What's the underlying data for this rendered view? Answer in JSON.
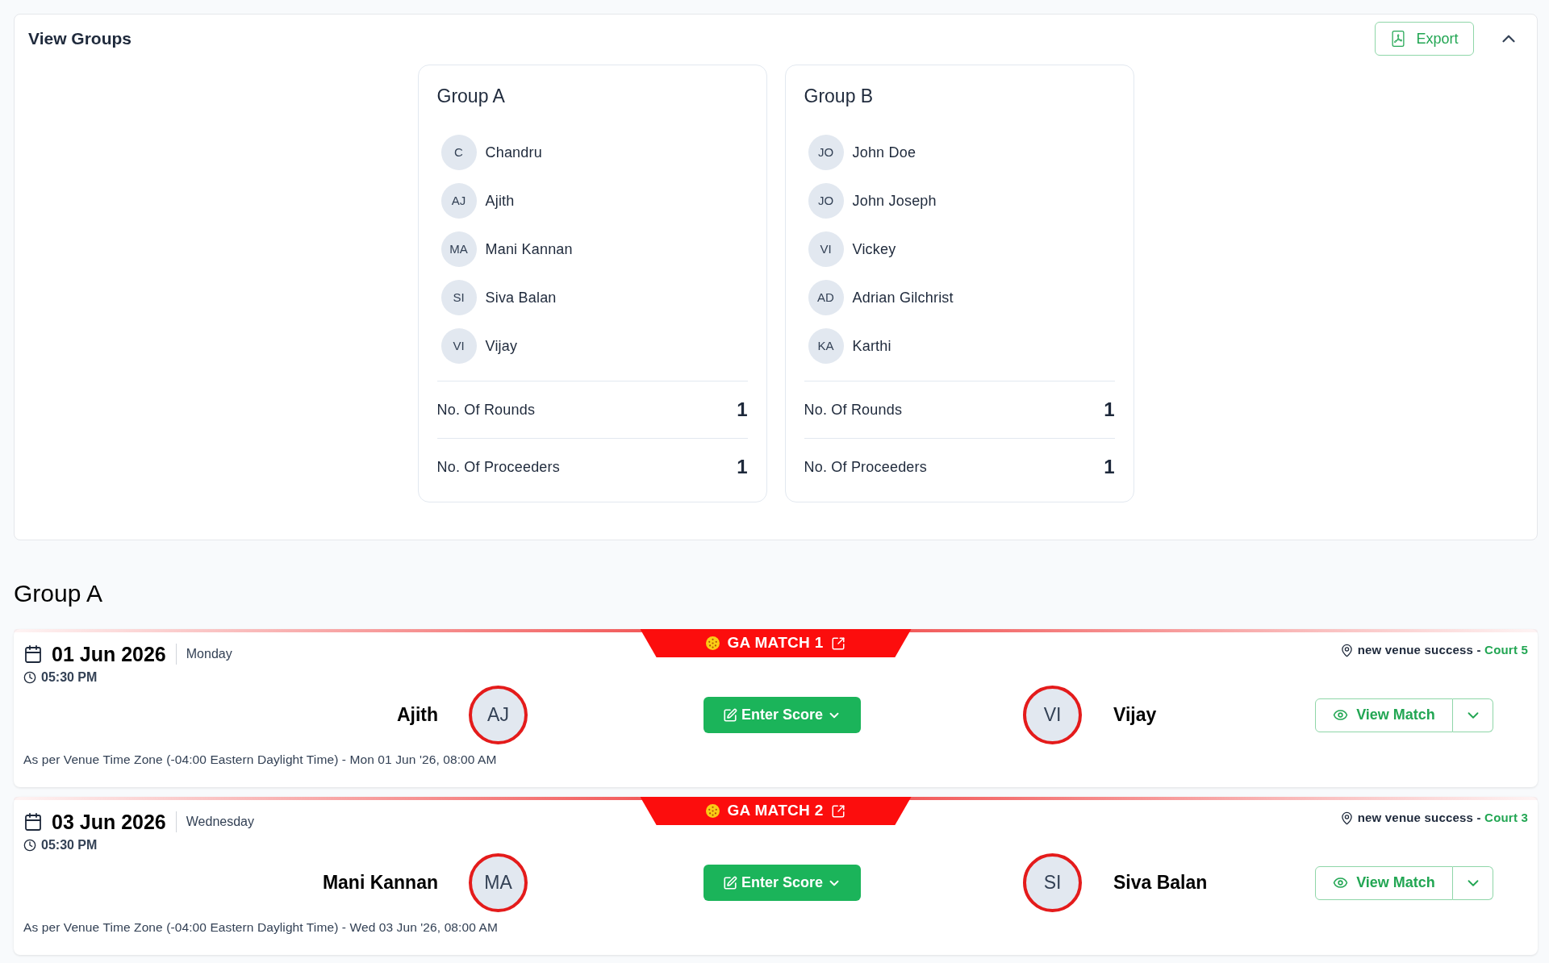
{
  "panel": {
    "title": "View Groups",
    "export_button": "Export",
    "expanded": true
  },
  "groups": [
    {
      "name": "Group A",
      "members": [
        {
          "initials": "C",
          "name": "Chandru"
        },
        {
          "initials": "AJ",
          "name": "Ajith"
        },
        {
          "initials": "MA",
          "name": "Mani Kannan"
        },
        {
          "initials": "SI",
          "name": "Siva Balan"
        },
        {
          "initials": "VI",
          "name": "Vijay"
        }
      ],
      "stats": [
        {
          "label": "No. Of Rounds",
          "value": "1"
        },
        {
          "label": "No. Of Proceeders",
          "value": "1"
        }
      ]
    },
    {
      "name": "Group B",
      "members": [
        {
          "initials": "JO",
          "name": "John Doe"
        },
        {
          "initials": "JO",
          "name": "John Joseph"
        },
        {
          "initials": "VI",
          "name": "Vickey"
        },
        {
          "initials": "AD",
          "name": "Adrian Gilchrist"
        },
        {
          "initials": "KA",
          "name": "Karthi"
        }
      ],
      "stats": [
        {
          "label": "No. Of Rounds",
          "value": "1"
        },
        {
          "label": "No. Of Proceeders",
          "value": "1"
        }
      ]
    }
  ],
  "schedule": {
    "title": "Group A",
    "matches": [
      {
        "title": "GA MATCH 1",
        "date": "01 Jun 2026",
        "weekday": "Monday",
        "time": "05:30 PM",
        "venue": "new venue success -",
        "court": "Court 5",
        "home": {
          "name": "Ajith",
          "initials": "AJ"
        },
        "away": {
          "name": "Vijay",
          "initials": "VI"
        },
        "score_button": "Enter Score",
        "view_button": "View Match",
        "timezone_note": "As per Venue Time Zone (-04:00 Eastern Daylight Time) - Mon 01 Jun '26, 08:00 AM"
      },
      {
        "title": "GA MATCH 2",
        "date": "03 Jun 2026",
        "weekday": "Wednesday",
        "time": "05:30 PM",
        "venue": "new venue success -",
        "court": "Court 3",
        "home": {
          "name": "Mani Kannan",
          "initials": "MA"
        },
        "away": {
          "name": "Siva Balan",
          "initials": "SI"
        },
        "score_button": "Enter Score",
        "view_button": "View Match",
        "timezone_note": "As per Venue Time Zone (-04:00 Eastern Daylight Time) - Wed 03 Jun '26, 08:00 AM"
      }
    ]
  }
}
